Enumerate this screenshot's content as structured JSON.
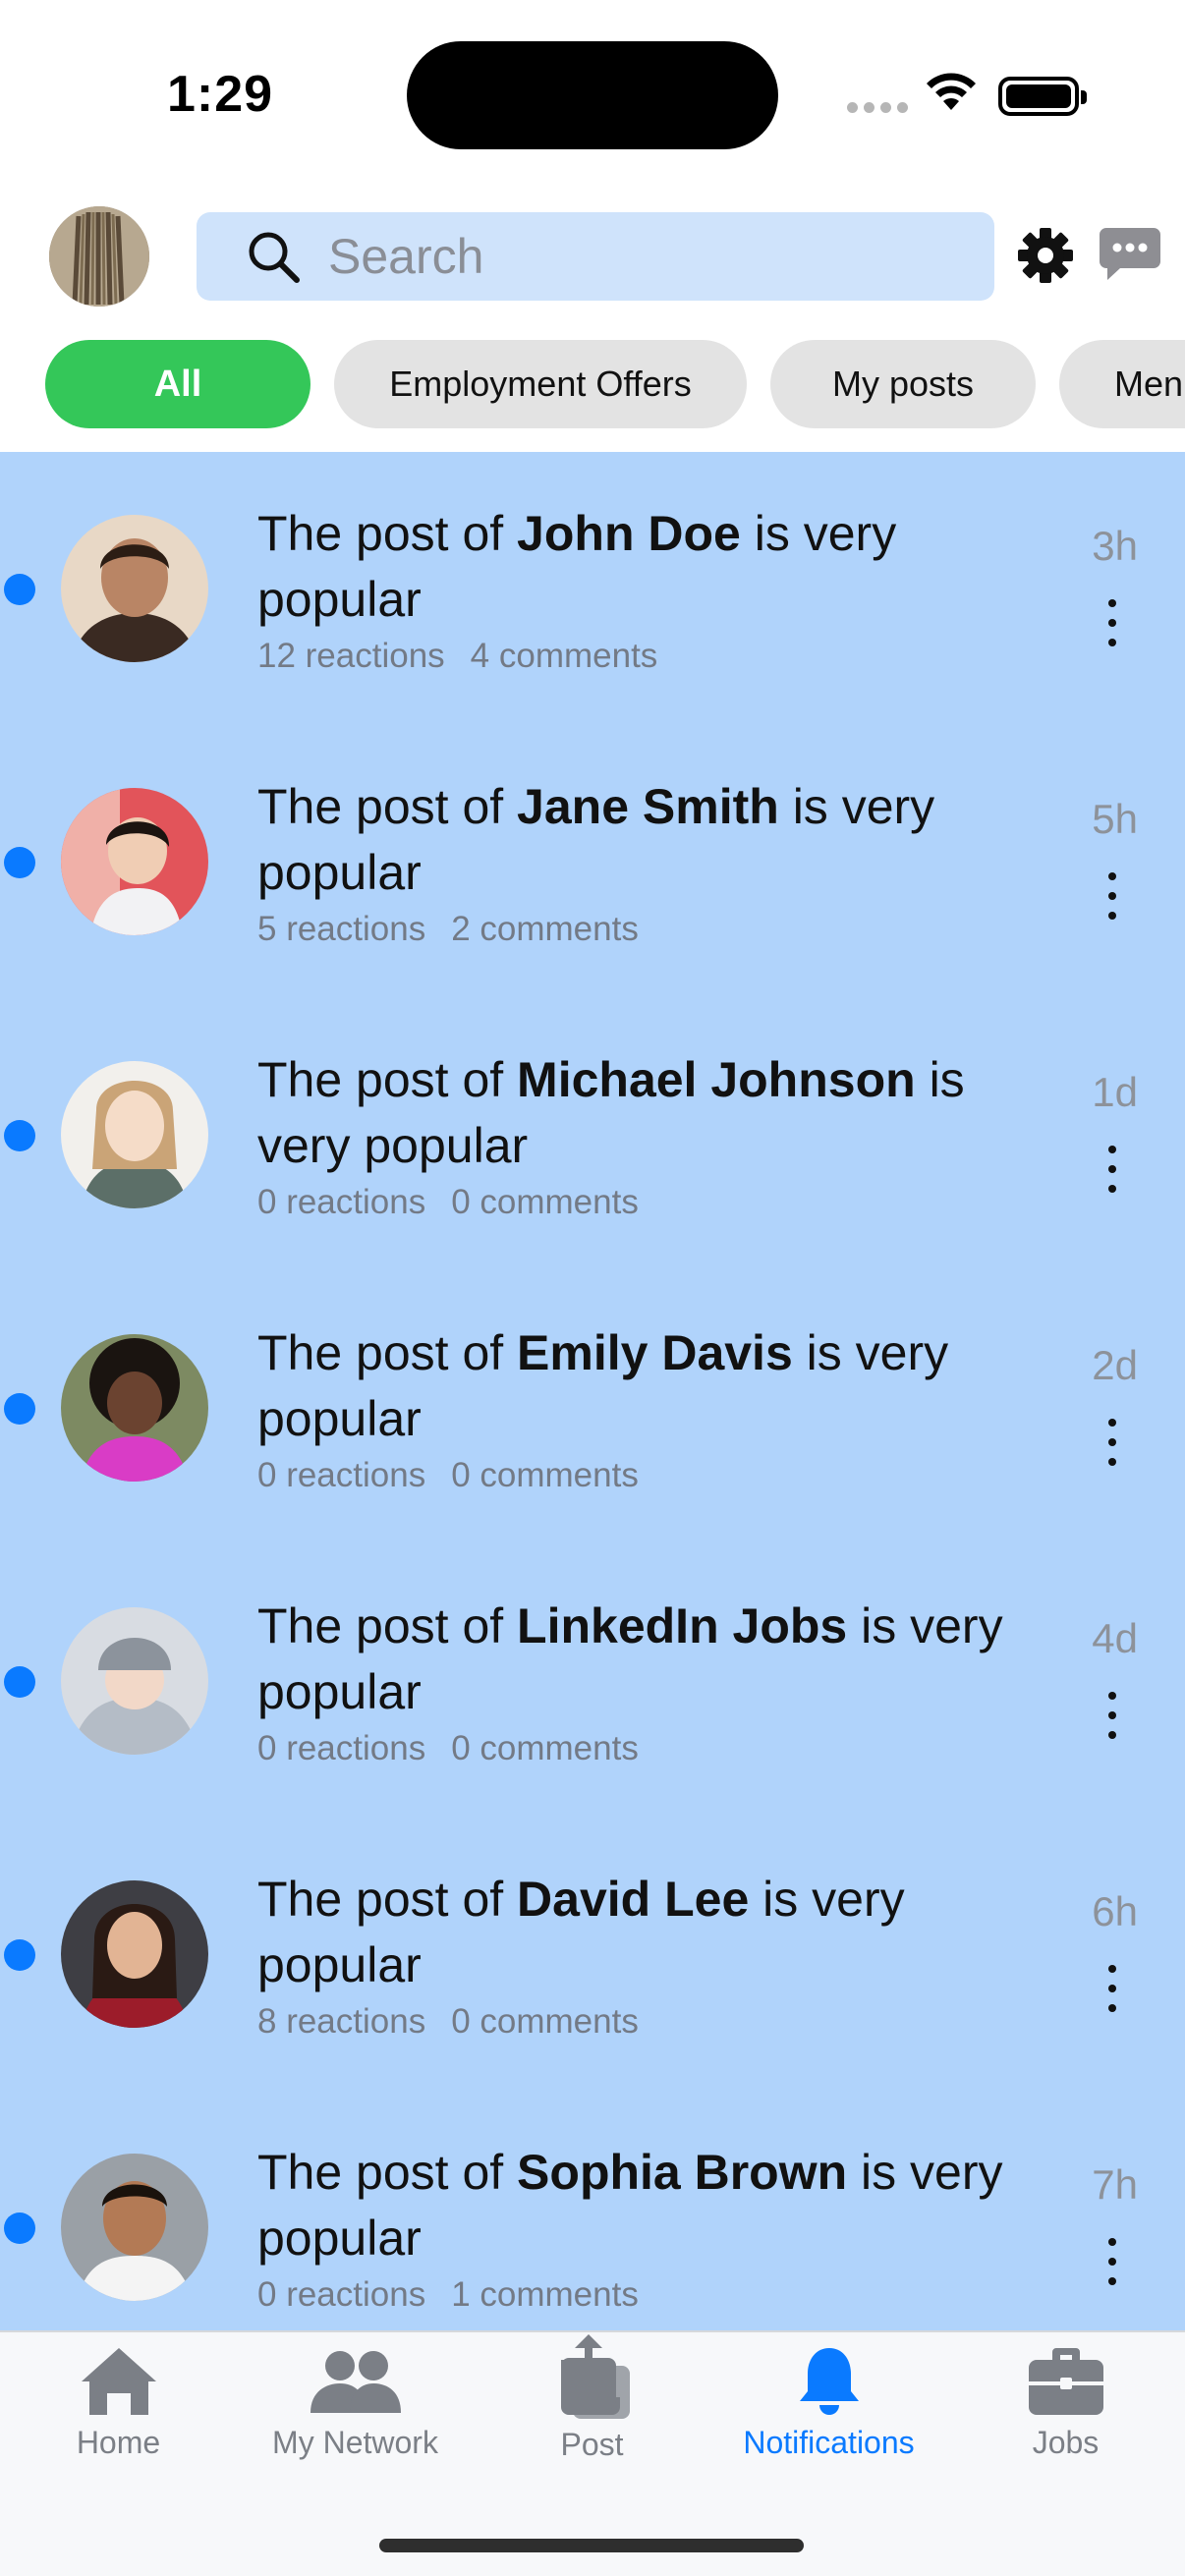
{
  "status_bar": {
    "time": "1:29"
  },
  "search": {
    "placeholder": "Search"
  },
  "filters": [
    "All",
    "Employment Offers",
    "My posts",
    "Men"
  ],
  "notifications": [
    {
      "prefix": "The post of ",
      "name": "John Doe",
      "suffix": " is very popular",
      "reactions": "12 reactions",
      "comments": "4 comments",
      "time": "3h"
    },
    {
      "prefix": "The post of ",
      "name": "Jane Smith",
      "suffix": " is very popular",
      "reactions": "5 reactions",
      "comments": "2 comments",
      "time": "5h"
    },
    {
      "prefix": "The post of ",
      "name": "Michael Johnson",
      "suffix": " is very popular",
      "reactions": "0 reactions",
      "comments": "0 comments",
      "time": "1d"
    },
    {
      "prefix": "The post of ",
      "name": "Emily Davis",
      "suffix": " is very popular",
      "reactions": "0 reactions",
      "comments": "0 comments",
      "time": "2d"
    },
    {
      "prefix": "The post of ",
      "name": "LinkedIn Jobs",
      "suffix": " is very popular",
      "reactions": "0 reactions",
      "comments": "0 comments",
      "time": "4d"
    },
    {
      "prefix": "The post of ",
      "name": "David Lee",
      "suffix": " is very popular",
      "reactions": "8 reactions",
      "comments": "0 comments",
      "time": "6h"
    },
    {
      "prefix": "The post of ",
      "name": "Sophia Brown",
      "suffix": " is very popular",
      "reactions": "0 reactions",
      "comments": "1 comments",
      "time": "7h"
    }
  ],
  "tabbar": {
    "items": [
      {
        "label": "Home",
        "icon": "house-icon"
      },
      {
        "label": "My Network",
        "icon": "people-icon"
      },
      {
        "label": "Post",
        "icon": "share-icon"
      },
      {
        "label": "Notifications",
        "icon": "bell-icon"
      },
      {
        "label": "Jobs",
        "icon": "briefcase-icon"
      }
    ],
    "active": "Notifications"
  },
  "colors": {
    "accent": "#0a7aff",
    "chip_active": "#34c759",
    "list_background": "#b0d3fb",
    "search_background": "#cfe3fb"
  }
}
